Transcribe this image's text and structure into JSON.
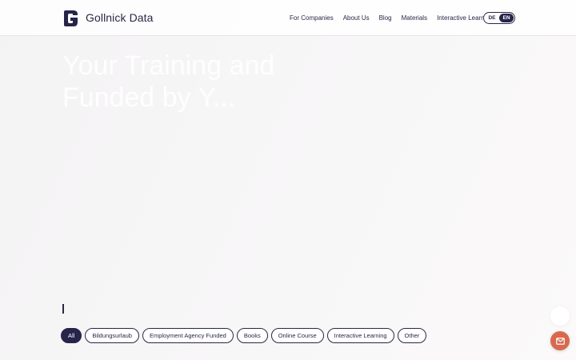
{
  "brand": {
    "name": "Gollnick Data",
    "logo": "g-logo-icon"
  },
  "nav": {
    "items": [
      {
        "label": "For Companies"
      },
      {
        "label": "About Us"
      },
      {
        "label": "Blog"
      },
      {
        "label": "Materials"
      },
      {
        "label": "Interactive Learning"
      }
    ]
  },
  "language": {
    "options": [
      "DE",
      "EN"
    ],
    "selected": "EN"
  },
  "hero": {
    "title": "Your Training and Funded by Y..."
  },
  "filters": {
    "selected": "All",
    "chips": [
      {
        "label": "All"
      },
      {
        "label": "Bildungsurlaub"
      },
      {
        "label": "Employment Agency Funded"
      },
      {
        "label": "Books"
      },
      {
        "label": "Online Course"
      },
      {
        "label": "Interactive Learning"
      },
      {
        "label": "Other"
      }
    ]
  },
  "contact": {
    "icon": "mail-icon"
  },
  "colors": {
    "primary": "#26244a",
    "accent": "#d9694e"
  }
}
